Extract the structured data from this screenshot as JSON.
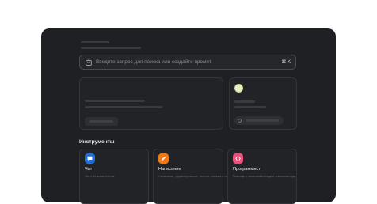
{
  "search": {
    "placeholder": "Введите запрос для поиска или создайте промпт",
    "shortcut": "⌘ K"
  },
  "tools": {
    "title": "Инструменты",
    "items": [
      {
        "label": "Чат",
        "description": "Чат с AI-ассистентом",
        "icon": "chat-icon",
        "color": "#1e6fd9"
      },
      {
        "label": "Написание",
        "description": "Написание, редактирование текстов, письма и постов",
        "icon": "pen-icon",
        "color": "#f07a1a"
      },
      {
        "label": "Программист",
        "description": "Помощь с написанием кода и анализом кода",
        "icon": "code-icon",
        "color": "#e8527a"
      }
    ]
  }
}
